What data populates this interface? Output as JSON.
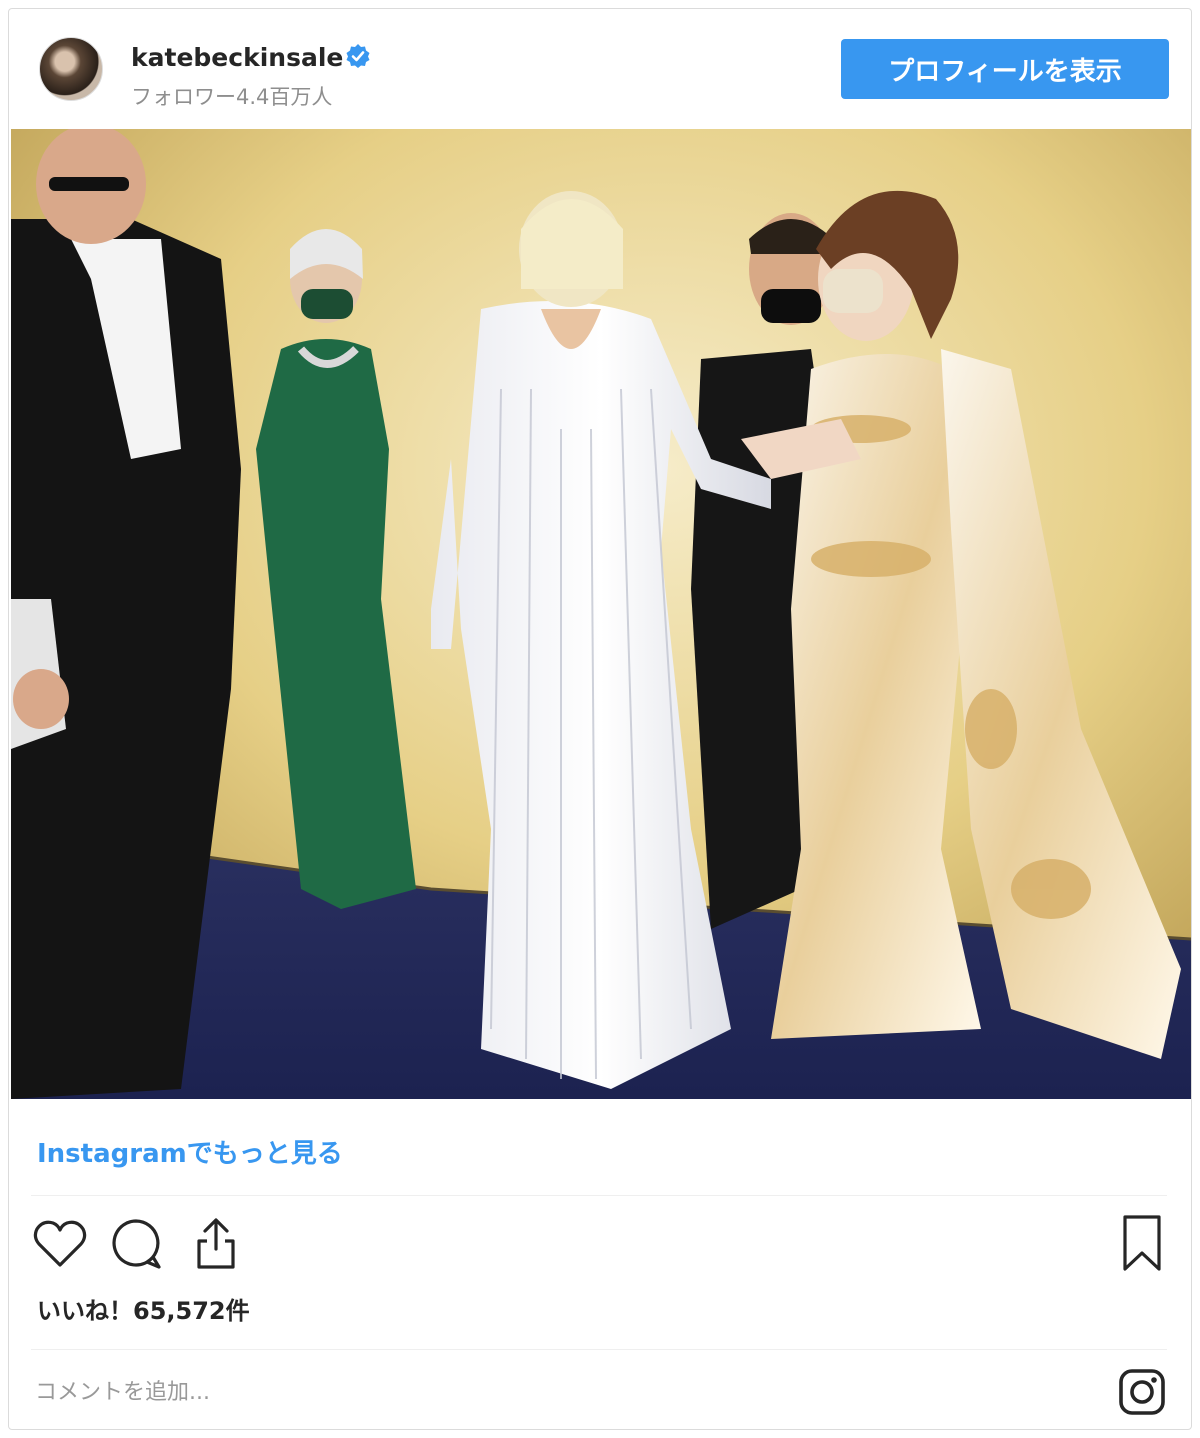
{
  "header": {
    "username": "katebeckinsale",
    "followers": "フォロワー4.4百万人",
    "profile_button": "プロフィールを表示"
  },
  "post": {
    "more_link": "Instagramでもっと見る",
    "likes": "いいね！65,572件"
  },
  "comment": {
    "placeholder": "コメントを追加..."
  },
  "colors": {
    "accent": "#3897f0",
    "verified": "#3897f0",
    "text": "#262626",
    "muted": "#8e8e8e"
  },
  "icons": [
    "verified-icon",
    "heart-icon",
    "comment-icon",
    "share-icon",
    "bookmark-icon",
    "instagram-icon"
  ]
}
